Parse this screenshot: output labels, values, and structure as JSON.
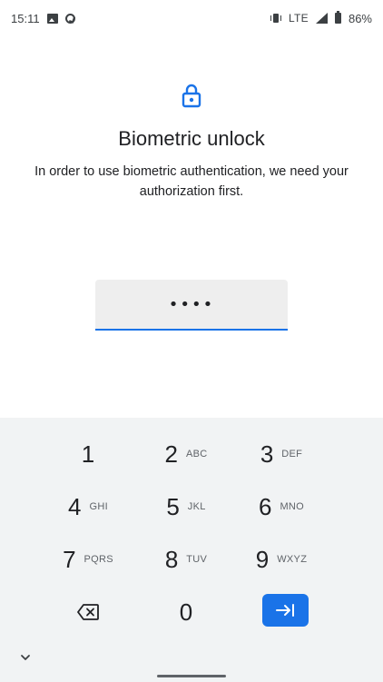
{
  "status_bar": {
    "time": "15:11",
    "network": "LTE",
    "battery": "86%",
    "icons": [
      "image-icon",
      "sync-icon",
      "vibrate-icon",
      "signal-icon",
      "battery-icon"
    ]
  },
  "header": {
    "icon": "lock-icon",
    "title": "Biometric unlock",
    "description": "In order to use biometric authentication, we need your authorization first."
  },
  "pin_field": {
    "value": "••••",
    "accent_color": "#1a73e8"
  },
  "keypad": {
    "keys": [
      {
        "num": "1",
        "letters": ""
      },
      {
        "num": "2",
        "letters": "ABC"
      },
      {
        "num": "3",
        "letters": "DEF"
      },
      {
        "num": "4",
        "letters": "GHI"
      },
      {
        "num": "5",
        "letters": "JKL"
      },
      {
        "num": "6",
        "letters": "MNO"
      },
      {
        "num": "7",
        "letters": "PQRS"
      },
      {
        "num": "8",
        "letters": "TUV"
      },
      {
        "num": "9",
        "letters": "WXYZ"
      },
      {
        "num": "0",
        "letters": ""
      }
    ],
    "backspace_icon": "backspace-icon",
    "enter_icon": "enter-icon",
    "enter_color": "#1a73e8",
    "collapse_icon": "chevron-down-icon"
  }
}
